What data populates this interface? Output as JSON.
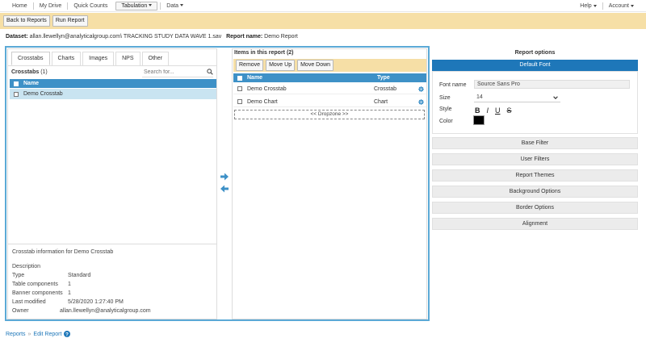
{
  "nav": {
    "items": [
      {
        "label": "Home"
      },
      {
        "label": "My Drive"
      },
      {
        "label": "Quick Counts"
      },
      {
        "label": "Tabulation"
      },
      {
        "label": "Data"
      }
    ],
    "right": [
      {
        "label": "Help"
      },
      {
        "label": "Account"
      }
    ]
  },
  "banner": {
    "back_label": "Back to Reports",
    "run_label": "Run Report"
  },
  "dataset": {
    "label": "Dataset:",
    "value": "allan.llewellyn@analyticalgroup.com\\ TRACKING STUDY DATA WAVE 1.sav",
    "report_label": "Report name:",
    "report_value": "Demo Report"
  },
  "left": {
    "tabs": [
      "Crosstabs",
      "Charts",
      "Images",
      "NPS",
      "Other"
    ],
    "list_title": "Crosstabs",
    "list_count": "(1)",
    "search_placeholder": "Search for...",
    "header_name": "Name",
    "rows": [
      "Demo Crosstab"
    ],
    "info_title": "Crosstab information for Demo Crosstab",
    "info": [
      {
        "label": "Description",
        "value": ""
      },
      {
        "label": "Type",
        "value": "Standard"
      },
      {
        "label": "Table components",
        "value": "1"
      },
      {
        "label": "Banner components",
        "value": "1"
      },
      {
        "label": "Last modified",
        "value": "5/28/2020 1:27:40 PM"
      },
      {
        "label": "Owner",
        "value": "allan.llewellyn@analyticalgroup.com"
      }
    ]
  },
  "middle": {
    "title": "Items in this report (2)",
    "buttons": [
      "Remove",
      "Move Up",
      "Move Down"
    ],
    "header_name": "Name",
    "header_type": "Type",
    "rows": [
      {
        "name": "Demo Crosstab",
        "type": "Crosstab"
      },
      {
        "name": "Demo Chart",
        "type": "Chart"
      }
    ],
    "dropzone": "<< Dropzone >>"
  },
  "right": {
    "title": "Report options",
    "default_font": "Default Font",
    "font_name_label": "Font name",
    "font_name_value": "Source Sans Pro",
    "size_label": "Size",
    "size_value": "14",
    "style_label": "Style",
    "style_buttons": [
      "B",
      "I",
      "U",
      "S"
    ],
    "color_label": "Color",
    "color_value": "#000000",
    "sections": [
      "Base Filter",
      "User Filters",
      "Report Themes",
      "Background Options",
      "Border Options",
      "Alignment"
    ]
  },
  "footer": {
    "crumb1": "Reports",
    "sep": "»",
    "crumb2": "Edit Report"
  },
  "colors": {
    "accent": "#1e77b9",
    "header_blue": "#3e91c7",
    "banner": "#f6dfa6",
    "selected_row": "#c9e4f1"
  }
}
